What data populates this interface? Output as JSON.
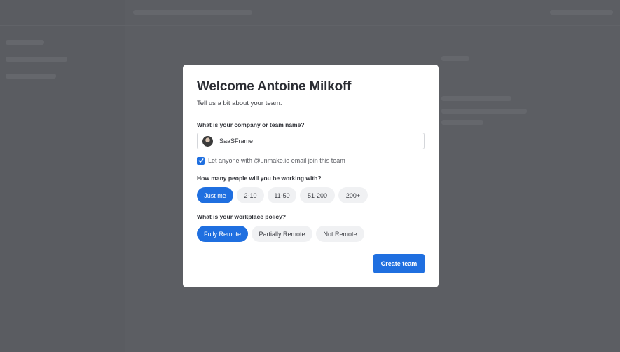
{
  "colors": {
    "accent": "#1f6fe0",
    "backdrop": "#5c5e63",
    "pill_bg": "#f0f1f3"
  },
  "modal": {
    "title": "Welcome Antoine Milkoff",
    "subtitle": "Tell us a bit about your team.",
    "team_name": {
      "label": "What is your company or team name?",
      "value": "SaaSFrame",
      "avatar_icon": "user-avatar"
    },
    "join_checkbox": {
      "checked": true,
      "label": "Let anyone with @unmake.io email join this team"
    },
    "people": {
      "label": "How many people will you be working with?",
      "selected": "Just me",
      "options": [
        "Just me",
        "2-10",
        "11-50",
        "51-200",
        "200+"
      ]
    },
    "policy": {
      "label": "What is your workplace policy?",
      "selected": "Fully Remote",
      "options": [
        "Fully Remote",
        "Partially Remote",
        "Not Remote"
      ]
    },
    "submit_label": "Create team"
  }
}
